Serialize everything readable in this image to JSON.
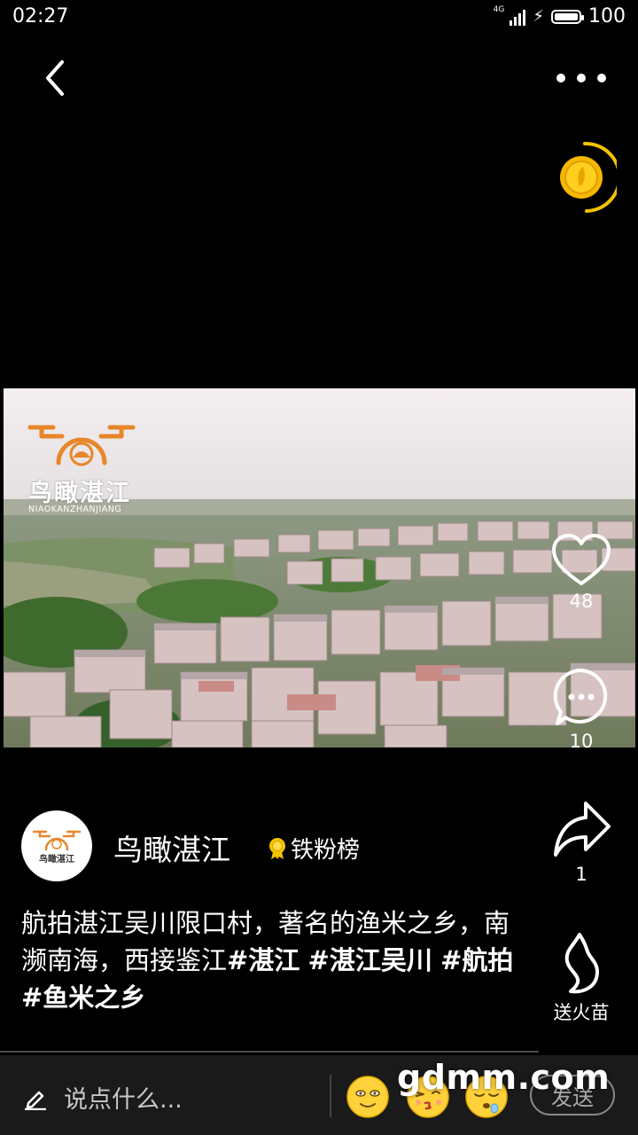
{
  "status_bar": {
    "time": "02:27",
    "network": "4G",
    "battery": "100"
  },
  "icons": {
    "back": "chevron-left-icon",
    "more": "more-dots-icon",
    "coin": "gold-coin-icon",
    "like": "heart-icon",
    "comment": "comment-bubble-icon",
    "share": "share-arrow-icon",
    "gift": "flame-icon",
    "badge": "medal-icon",
    "compose": "pencil-icon"
  },
  "video": {
    "watermark_title": "鸟瞰湛江",
    "watermark_subtitle": "NIAOKANZHANJIANG"
  },
  "actions": {
    "like_count": "48",
    "comment_count": "10",
    "share_count": "1",
    "gift_label": "送火苗"
  },
  "author": {
    "name": "鸟瞰湛江",
    "avatar_title": "鸟瞰湛江",
    "badge_label": "铁粉榜"
  },
  "caption": {
    "text": "航拍湛江吴川限口村，著名的渔米之乡，南濒南海，西接鉴江",
    "tags": [
      "#湛江",
      "#湛江吴川",
      "#航拍",
      "#鱼米之乡"
    ]
  },
  "comment_bar": {
    "placeholder": "说点什么...",
    "send_label": "发送"
  },
  "site_watermark": "gdmm.com",
  "colors": {
    "background": "#000000",
    "accent_yellow": "#f5c400",
    "logo_orange": "#e8862a",
    "bottom_bar": "#1a1a1a"
  }
}
